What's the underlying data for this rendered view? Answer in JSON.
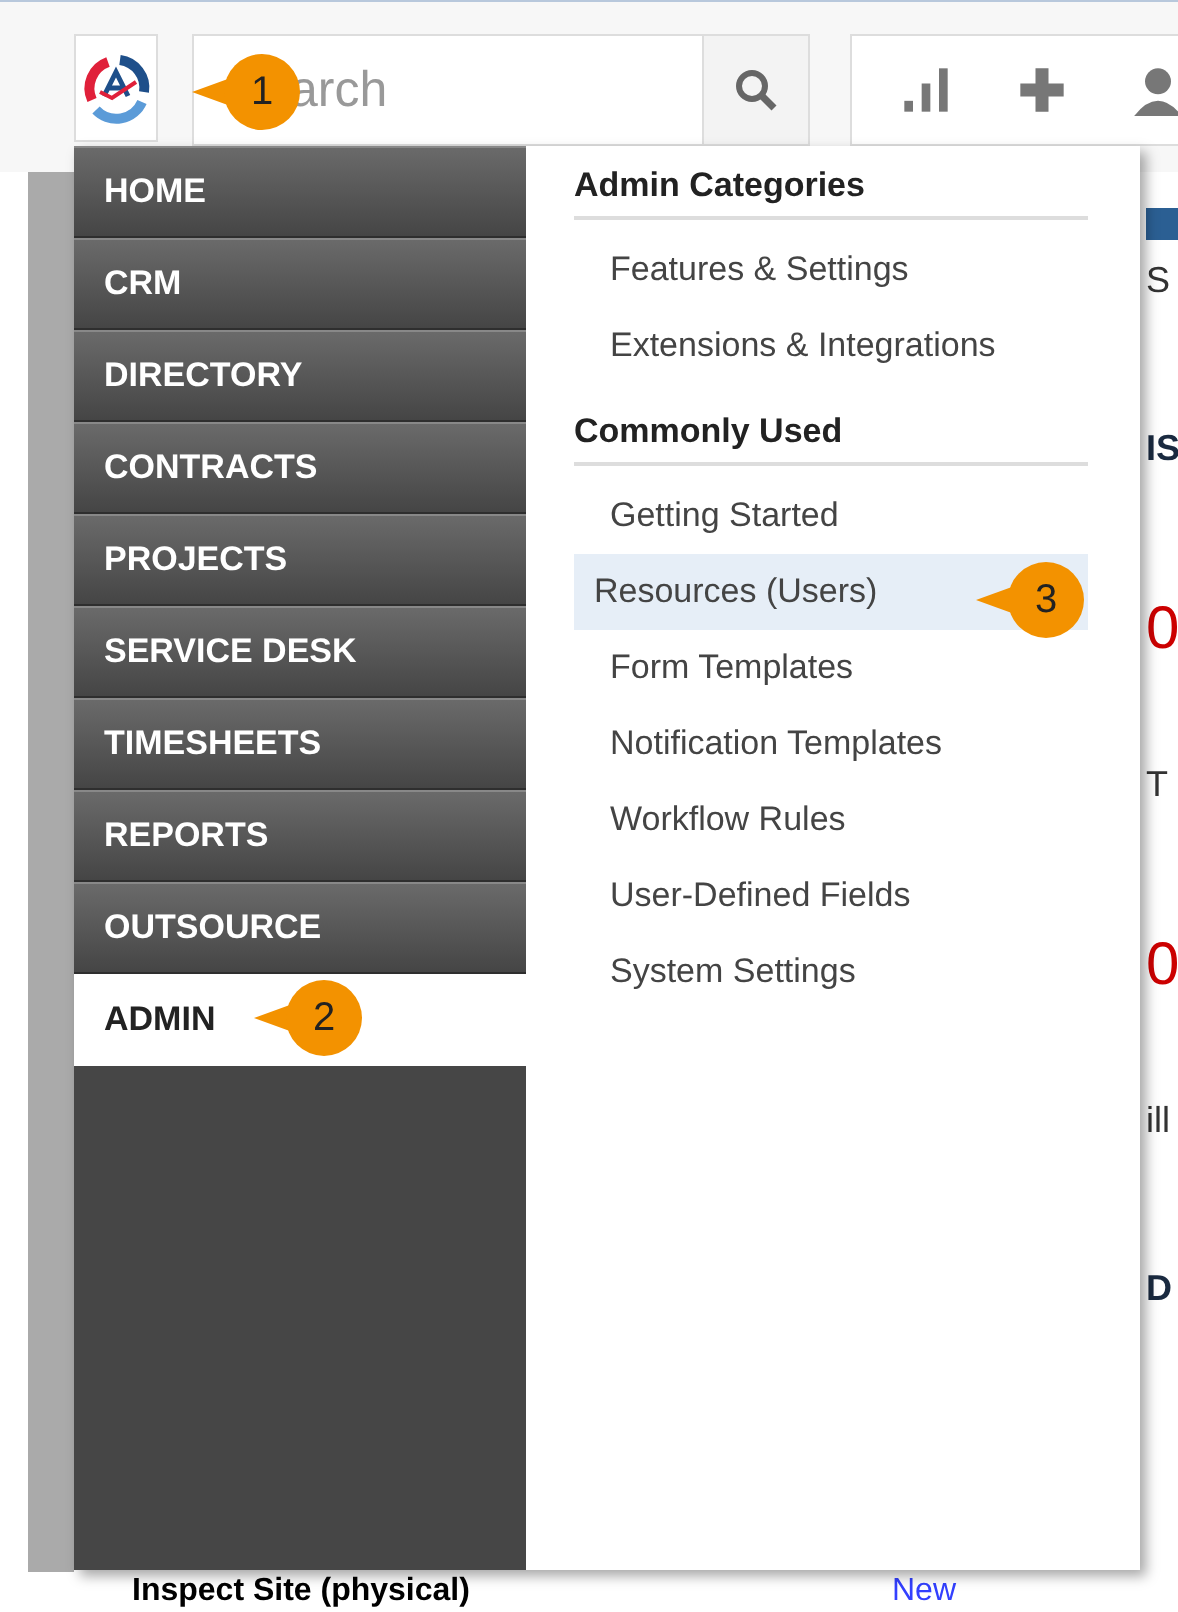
{
  "search": {
    "placeholder": "arch"
  },
  "nav": [
    {
      "label": "HOME",
      "selected": false
    },
    {
      "label": "CRM",
      "selected": false
    },
    {
      "label": "DIRECTORY",
      "selected": false
    },
    {
      "label": "CONTRACTS",
      "selected": false
    },
    {
      "label": "PROJECTS",
      "selected": false
    },
    {
      "label": "SERVICE DESK",
      "selected": false
    },
    {
      "label": "TIMESHEETS",
      "selected": false
    },
    {
      "label": "REPORTS",
      "selected": false
    },
    {
      "label": "OUTSOURCE",
      "selected": false
    },
    {
      "label": "ADMIN",
      "selected": true
    }
  ],
  "admin_menu": [
    {
      "heading": "Admin Categories",
      "items": [
        {
          "label": "Features & Settings",
          "selected": false
        },
        {
          "label": "Extensions & Integrations",
          "selected": false
        }
      ]
    },
    {
      "heading": "Commonly Used",
      "items": [
        {
          "label": "Getting Started",
          "selected": false
        },
        {
          "label": "Resources (Users)",
          "selected": true
        },
        {
          "label": "Form Templates",
          "selected": false
        },
        {
          "label": "Notification Templates",
          "selected": false
        },
        {
          "label": "Workflow Rules",
          "selected": false
        },
        {
          "label": "User-Defined Fields",
          "selected": false
        },
        {
          "label": "System Settings",
          "selected": false
        }
      ]
    }
  ],
  "callouts": [
    {
      "number": "1"
    },
    {
      "number": "2"
    },
    {
      "number": "3"
    }
  ],
  "page_behind": {
    "fragments": [
      {
        "text": "S",
        "kind": "label"
      },
      {
        "text": "IS",
        "kind": "heading"
      },
      {
        "text": "0",
        "kind": "number"
      },
      {
        "text": "T",
        "kind": "label"
      },
      {
        "text": "0",
        "kind": "number"
      },
      {
        "text": "ill",
        "kind": "label"
      },
      {
        "text": "D",
        "kind": "heading"
      }
    ],
    "row": {
      "task": "Inspect Site (physical)",
      "status": "New"
    }
  }
}
